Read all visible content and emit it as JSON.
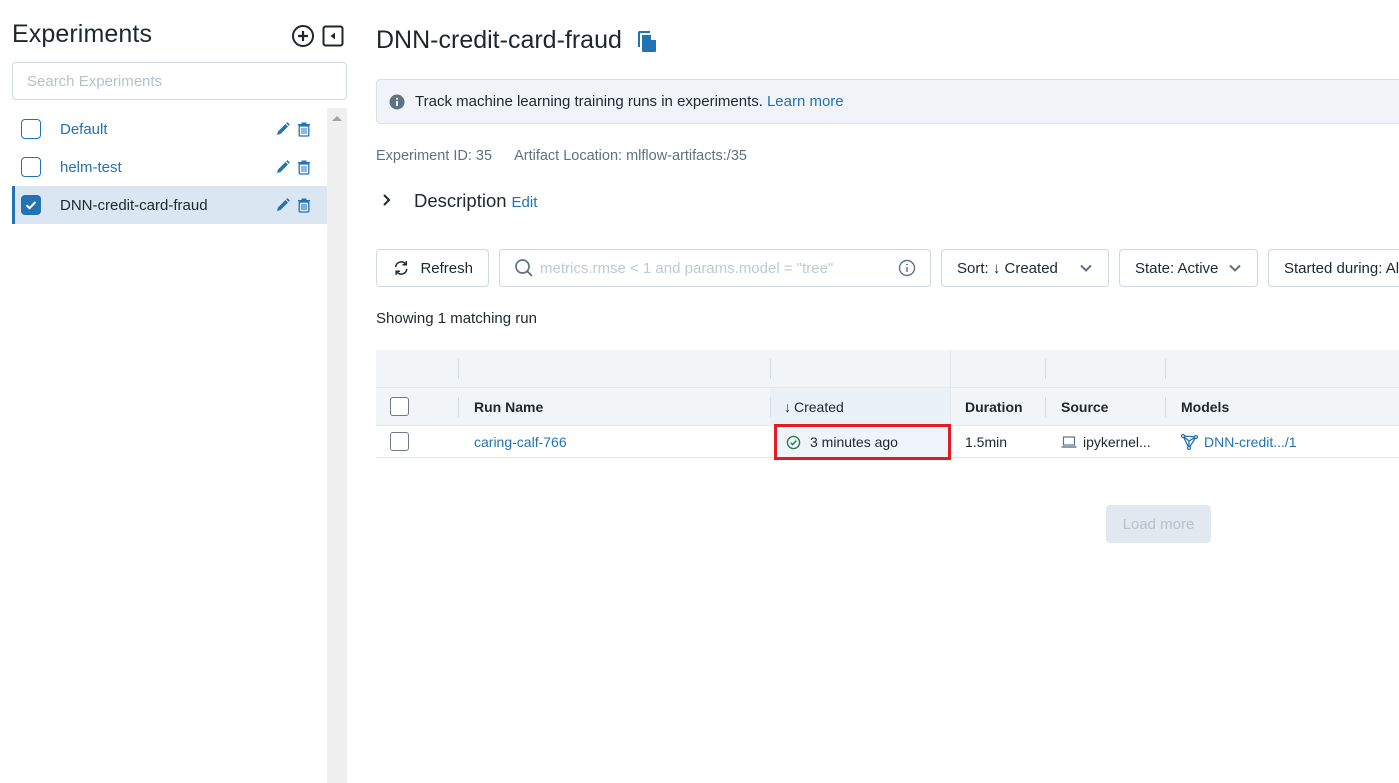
{
  "sidebar": {
    "title": "Experiments",
    "search_placeholder": "Search Experiments",
    "items": [
      {
        "label": "Default",
        "checked": false,
        "active": false
      },
      {
        "label": "helm-test",
        "checked": false,
        "active": false
      },
      {
        "label": "DNN-credit-card-fraud",
        "checked": true,
        "active": true
      }
    ]
  },
  "header": {
    "title": "DNN-credit-card-fraud"
  },
  "banner": {
    "text": "Track machine learning training runs in experiments.",
    "link": "Learn more"
  },
  "meta": {
    "experiment_id": "Experiment ID: 35",
    "artifact_location": "Artifact Location: mlflow-artifacts:/35"
  },
  "description": {
    "label": "Description",
    "edit": "Edit"
  },
  "toolbar": {
    "refresh": "Refresh",
    "search_placeholder": "metrics.rmse < 1 and params.model = \"tree\"",
    "sort": "Sort: ↓ Created",
    "state": "State: Active",
    "started": "Started during: All"
  },
  "showing": "Showing 1 matching run",
  "table": {
    "columns": {
      "run_name": "Run Name",
      "created": "Created",
      "created_sort_arrow": "↓",
      "duration": "Duration",
      "source": "Source",
      "models": "Models"
    },
    "rows": [
      {
        "run_name": "caring-calf-766",
        "created": "3 minutes ago",
        "status": "finished",
        "duration": "1.5min",
        "source": "ipykernel...",
        "model": "DNN-credit.../1"
      }
    ]
  },
  "load_more": "Load more",
  "colors": {
    "accent": "#2272b4",
    "highlight_box": "#e31b23",
    "success": "#277c43",
    "active_row_bg": "#dae6f1"
  }
}
